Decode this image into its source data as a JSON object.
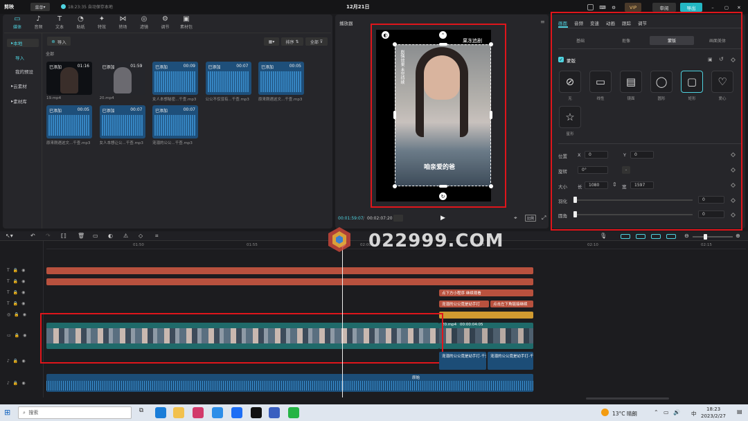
{
  "app": {
    "logo_text": "剪映",
    "menu_label": "菜单",
    "autosave": "18:23:35 自动保存本地",
    "date_title": "12月21日",
    "review_btn": "审阅",
    "export_btn": "导出",
    "vip_label": "VIP"
  },
  "toolbar": [
    {
      "label": "媒体",
      "icon": "▭"
    },
    {
      "label": "音频",
      "icon": "♪"
    },
    {
      "label": "文本",
      "icon": "T"
    },
    {
      "label": "贴纸",
      "icon": "◔"
    },
    {
      "label": "特效",
      "icon": "✦"
    },
    {
      "label": "转场",
      "icon": "⋈"
    },
    {
      "label": "滤镜",
      "icon": "◎"
    },
    {
      "label": "调节",
      "icon": "⚙"
    },
    {
      "label": "素材包",
      "icon": "▣"
    }
  ],
  "sidebar": {
    "items": [
      "本地",
      "导入",
      "我的预设",
      "云素材",
      "素材库"
    ]
  },
  "media": {
    "import_btn": "导入",
    "all_label": "全部",
    "sort_label": "排序",
    "filter_label": "全部",
    "items": [
      {
        "status": "已添加",
        "duration": "01:16",
        "name": "19.mp4",
        "kind": "video"
      },
      {
        "status": "已添加",
        "duration": "01:59",
        "name": "20.mp4",
        "kind": "video"
      },
      {
        "status": "已添加",
        "duration": "00:09",
        "name": "女人本想秘密...千查.mp3",
        "kind": "audio"
      },
      {
        "status": "已添加",
        "duration": "00:07",
        "name": "公公不仅没有...千查.mp3",
        "kind": "audio"
      },
      {
        "status": "已添加",
        "duration": "00:05",
        "name": "原来刚遇这文...千查.mp3",
        "kind": "audio"
      },
      {
        "status": "已添加",
        "duration": "00:05",
        "name": "原来刚遇这文...千查.mp3",
        "kind": "audio"
      },
      {
        "status": "已添加",
        "duration": "00:07",
        "name": "女人本想让公...千查.mp3",
        "kind": "audio"
      },
      {
        "status": "已添加",
        "duration": "00:07",
        "name": "宠溺的公公...千查.mp3",
        "kind": "audio"
      }
    ]
  },
  "player": {
    "title": "播放器",
    "vertical_text": "剧情效果 未完待续",
    "top_caption": "果冻追剧",
    "subtitle": "咱亲爱的爸",
    "time_current": "00:01:59:07",
    "time_total": "00:02:07:20",
    "ratio_label": "比例"
  },
  "props": {
    "tabs": [
      "画面",
      "音频",
      "变速",
      "动画",
      "跟踪",
      "调节"
    ],
    "subtabs": [
      "基础",
      "抠像",
      "蒙版",
      "画面美体"
    ],
    "section_title": "蒙版",
    "masks": [
      "无",
      "线性",
      "镜面",
      "圆形",
      "矩形",
      "爱心",
      "星形"
    ],
    "position_label": "位置",
    "pos_x_label": "X",
    "pos_x": "0",
    "pos_y_label": "Y",
    "pos_y": "0",
    "rotate_label": "旋转",
    "rotate": "0°",
    "size_label": "大小",
    "width_label": "长",
    "width": "1080",
    "height_label": "宽",
    "height": "1597",
    "feather_label": "羽化",
    "feather": "0",
    "round_label": "圆角",
    "round": "0"
  },
  "timeline": {
    "ticks": [
      "01:50",
      "01:55",
      "02:00",
      "02:05",
      "02:10",
      "02:15"
    ],
    "text_clips": [
      "点下方小程序 继续观看",
      "宠溺的公公竟是幼手打",
      "点击左下角链接继续"
    ],
    "video_clip_label": "20.mp4",
    "video_clip_time": "00:00:04:05",
    "audio_clip_label": "宠溺的公公竟是幼手打-千查",
    "audio_clip_label2": "宠溺的公公竟是幼手打-千查",
    "music_label": "原始"
  },
  "watermark": "022999.COM",
  "taskbar": {
    "search_placeholder": "搜索",
    "weather": "13°C 晴朗",
    "time": "18:23",
    "date": "2023/2/27",
    "lang": "中"
  },
  "colors": {
    "accent": "#4fd3e0",
    "text_clip": "#b8513e",
    "video_clip": "#1f6a6a",
    "audio_clip": "#1c4d77",
    "highlight": "#e0151b"
  }
}
